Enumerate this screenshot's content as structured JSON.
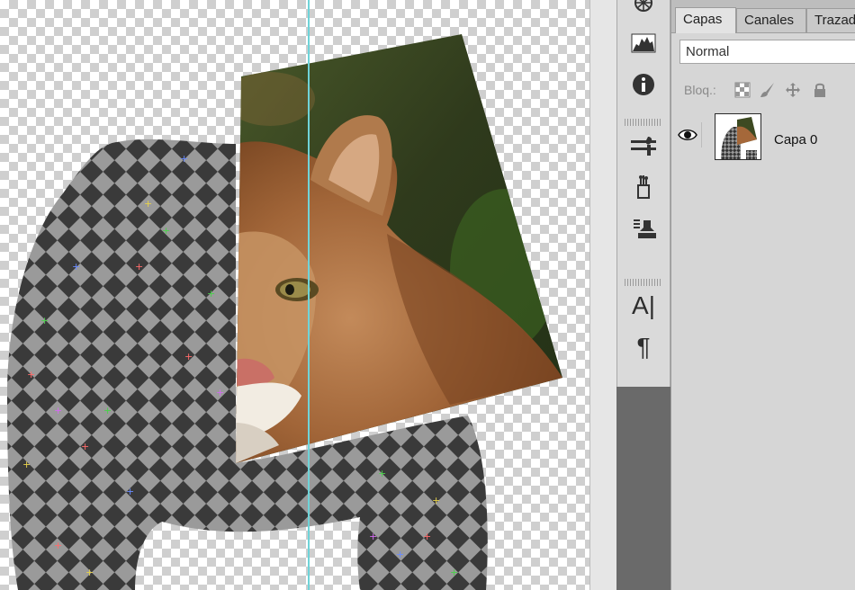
{
  "layers_panel": {
    "tabs": [
      "Capas",
      "Canales",
      "Trazados"
    ],
    "active_tab": "Capas",
    "blend_mode": "Normal",
    "lock_label": "Bloq.:",
    "lock_icons": [
      "lock-transparent-pixels-icon",
      "lock-image-pixels-icon",
      "lock-position-icon",
      "lock-all-icon"
    ],
    "layers": [
      {
        "name": "Capa 0",
        "visible": true,
        "thumbnail": "puppet-warped-cougar-thumbnail"
      }
    ]
  },
  "tool_dock": {
    "icons": [
      "navigator-icon",
      "histogram-icon",
      "info-icon",
      "brushes-icon",
      "tool-presets-icon",
      "clone-source-icon",
      "character-icon",
      "paragraph-icon"
    ],
    "character_glyph": "A|",
    "paragraph_glyph": "¶"
  },
  "canvas": {
    "guide_color": "#6fd3d8",
    "mesh_dark": "#3a3a3a",
    "mesh_light": "#9a9a9a",
    "content": "puppet-warp-mesh-over-cougar-photo"
  }
}
